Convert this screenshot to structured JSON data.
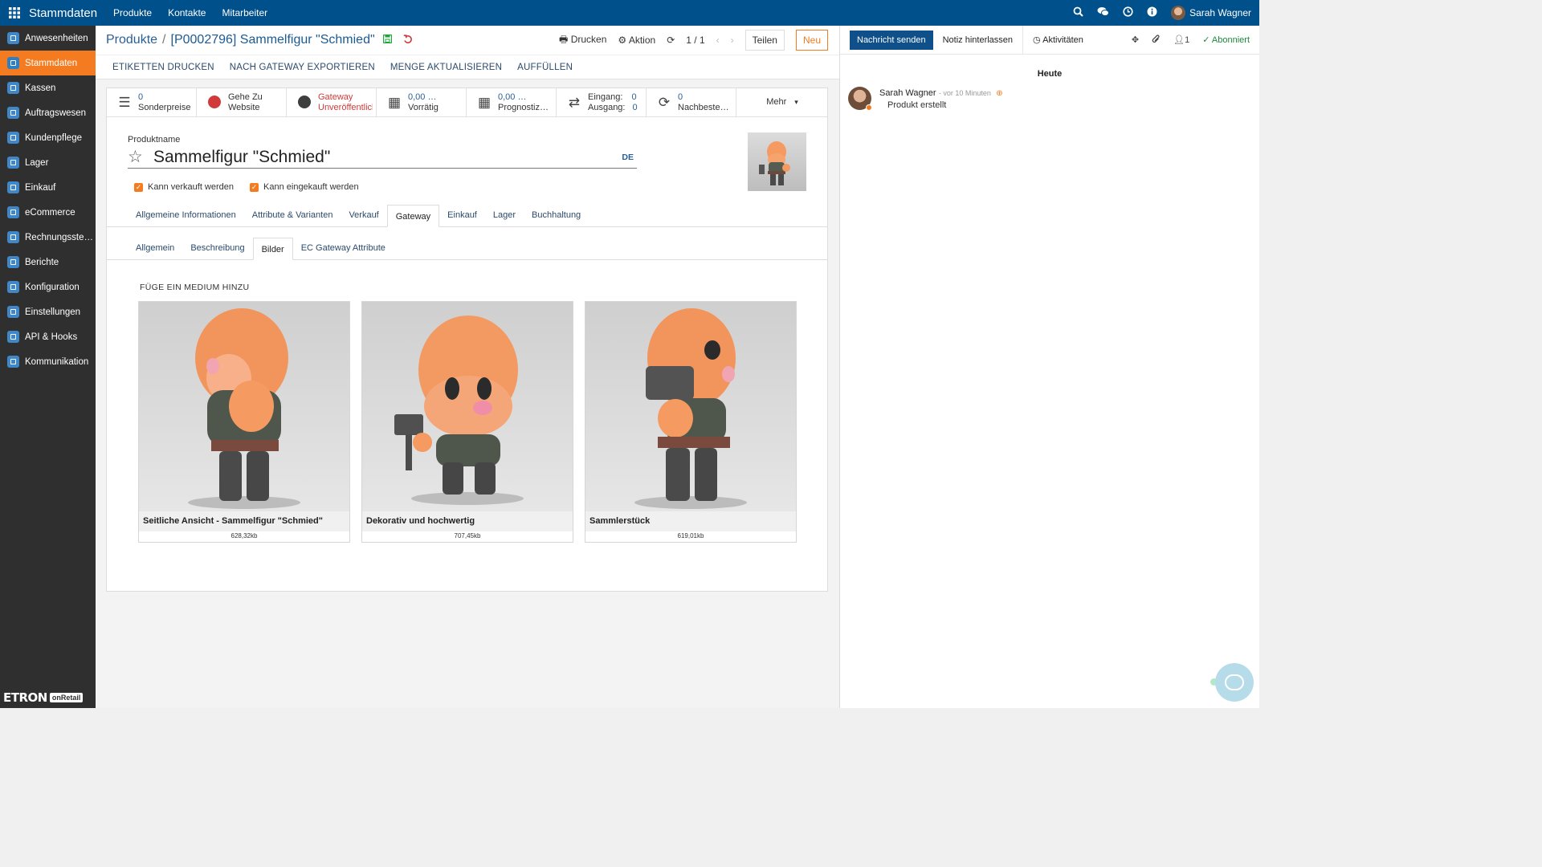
{
  "topbar": {
    "app_title": "Stammdaten",
    "menu": [
      "Produkte",
      "Kontakte",
      "Mitarbeiter"
    ],
    "user_name": "Sarah Wagner"
  },
  "sidebar": {
    "items": [
      {
        "label": "Anwesenheiten",
        "icon": "clock-icon"
      },
      {
        "label": "Stammdaten",
        "icon": "database-icon"
      },
      {
        "label": "Kassen",
        "icon": "register-icon"
      },
      {
        "label": "Auftragswesen",
        "icon": "chart-icon"
      },
      {
        "label": "Kundenpflege",
        "icon": "users-icon"
      },
      {
        "label": "Lager",
        "icon": "box-icon"
      },
      {
        "label": "Einkauf",
        "icon": "cart-icon"
      },
      {
        "label": "eCommerce",
        "icon": "globe-icon"
      },
      {
        "label": "Rechnungsste…",
        "icon": "receipt-icon"
      },
      {
        "label": "Berichte",
        "icon": "dashboard-icon"
      },
      {
        "label": "Konfiguration",
        "icon": "gears-icon"
      },
      {
        "label": "Einstellungen",
        "icon": "gear-icon"
      },
      {
        "label": "API & Hooks",
        "icon": "api-icon"
      },
      {
        "label": "Kommunikation",
        "icon": "chat-icon"
      }
    ],
    "active_index": 1,
    "logo_text": "ETRON",
    "logo_badge": "onRetail"
  },
  "control": {
    "breadcrumb_parent": "Produkte",
    "breadcrumb_sep": "/",
    "breadcrumb_current": "[P0002796] Sammelfigur \"Schmied\"",
    "print_label": "Drucken",
    "action_label": "Aktion",
    "pager": "1 / 1",
    "share_label": "Teilen",
    "new_label": "Neu"
  },
  "actions": [
    "ETIKETTEN DRUCKEN",
    "NACH GATEWAY EXPORTIEREN",
    "MENGE AKTUALISIEREN",
    "AUFFÜLLEN"
  ],
  "stats": [
    {
      "value": "0",
      "label": "Sonderpreise",
      "icon": "list-icon"
    },
    {
      "value": "Gehe Zu",
      "label": "Website",
      "icon": "globe-red-icon"
    },
    {
      "value": "Gateway",
      "label": "Unveröffentlicht",
      "icon": "globe-icon"
    },
    {
      "value": "0,00 …",
      "label": "Vorrätig",
      "icon": "cubes-icon"
    },
    {
      "value": "0,00 …",
      "label": "Prognostiz…",
      "icon": "cubes-icon"
    },
    {
      "in_label": "Eingang:",
      "in_value": "0",
      "out_label": "Ausgang:",
      "out_value": "0",
      "icon": "exchange-icon"
    },
    {
      "value": "0",
      "label": "Nachbeste…",
      "icon": "refresh-icon"
    }
  ],
  "stats_more": "Mehr",
  "form": {
    "name_label": "Produktname",
    "name_value": "Sammelfigur \"Schmied\"",
    "lang": "DE",
    "can_sell": "Kann verkauft werden",
    "can_buy": "Kann eingekauft werden"
  },
  "tabs": [
    "Allgemeine Informationen",
    "Attribute & Varianten",
    "Verkauf",
    "Gateway",
    "Einkauf",
    "Lager",
    "Buchhaltung"
  ],
  "active_tab": 3,
  "subtabs": [
    "Allgemein",
    "Beschreibung",
    "Bilder",
    "EC Gateway Attribute"
  ],
  "active_subtab": 2,
  "add_media": "FÜGE EIN MEDIUM HINZU",
  "images": [
    {
      "caption": "Seitliche Ansicht - Sammelfigur \"Schmied\"",
      "size": "628,32kb"
    },
    {
      "caption": "Dekorativ und hochwertig",
      "size": "707,45kb"
    },
    {
      "caption": "Sammlerstück",
      "size": "619,01kb"
    }
  ],
  "chatter": {
    "send_label": "Nachricht senden",
    "note_label": "Notiz hinterlassen",
    "activities_label": "Aktivitäten",
    "followers_count": "1",
    "follow_label": "Abonniert",
    "today": "Heute",
    "message": {
      "author": "Sarah Wagner",
      "time": "- vor 10 Minuten",
      "body": "Produkt erstellt"
    }
  },
  "colors": {
    "topbar": "#00508c",
    "accent": "#f47b20",
    "sidebar": "#2f2f2f",
    "primary_btn": "#0f4f8a"
  }
}
